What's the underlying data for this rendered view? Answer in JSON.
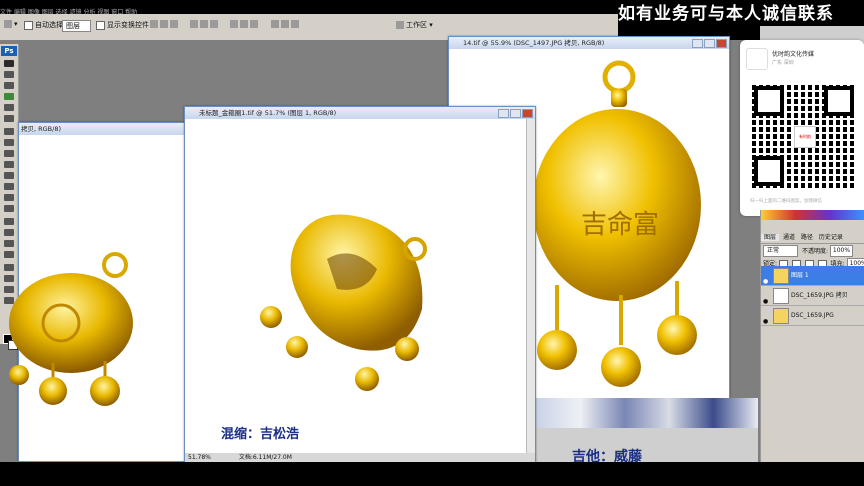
{
  "banner": {
    "text": "如有业务可与本人诚信联系"
  },
  "menu": {
    "strip": "文件  编辑  图像  图层  选择  滤镜  分析  视图  窗口  帮助"
  },
  "options": {
    "auto_select_label": "自动选择:",
    "auto_select_value": "图层",
    "show_transform_label": "显示变换控件",
    "workspace_label": "工作区 ▾"
  },
  "toolbox": {
    "logo": "Ps"
  },
  "windows": {
    "left_back": {
      "title": "拷贝, RGB/8)"
    },
    "center": {
      "title": "未标题_金箍圈1.tif @ 51.7% (图层 1, RGB/8)",
      "caption": "混缩：吉松浩",
      "status_zoom": "51.78%",
      "status_doc": "文档:6.11M/27.0M"
    },
    "right": {
      "title": "14.tif @ 55.9% (DSC_1497.JPG 拷贝, RGB/8)",
      "caption": "吉他：威藤"
    }
  },
  "qr": {
    "name": "优时韵文化传媒",
    "location": "广东 深圳",
    "hint": "扫一扫上面的二维码图案，加我微信",
    "logo_text": "有时韵"
  },
  "layers_panel": {
    "tabs": [
      "图层",
      "通道",
      "路径",
      "历史记录"
    ],
    "blend_mode": "正常",
    "opacity_label": "不透明度:",
    "opacity_value": "100%",
    "lock_label": "锁定:",
    "fill_label": "填充:",
    "fill_value": "100%",
    "layers": [
      {
        "name": "图层 1",
        "selected": true
      },
      {
        "name": "DSC_1659.JPG 拷贝",
        "selected": false
      },
      {
        "name": "DSC_1659.JPG",
        "selected": false
      }
    ]
  },
  "colors": {
    "selected_layer": "#3d7ee6",
    "gold": "#e8b800",
    "caption_blue": "#1b2f86"
  }
}
